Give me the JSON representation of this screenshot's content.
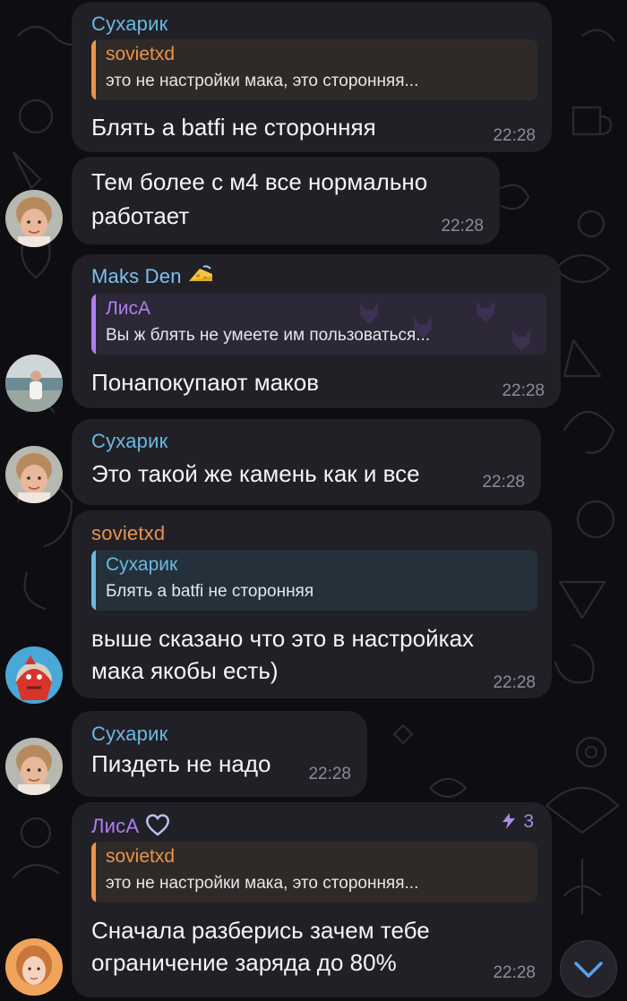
{
  "colors": {
    "background": "#0d0d12",
    "bubble": "#212027",
    "time": "#8d8b96",
    "sender_sukharik": "#6ab8e0",
    "sender_sovietxd": "#e8944a",
    "sender_maks": "#7ac2f0",
    "sender_lisa": "#b07ef0",
    "reply_orange_bg": "#2f2a28",
    "reply_purple_bg": "#2c2838",
    "reply_blue_bg": "#24313a"
  },
  "messages": [
    {
      "sender": "Сухарик",
      "reply": {
        "name": "sovietxd",
        "text": "это не настройки мака, это сторонняя..."
      },
      "text": "Блять а batfi не сторонняя",
      "time": "22:28"
    },
    {
      "text_line1": "Тем более с м4 все нормально",
      "text_line2": "работает",
      "time": "22:28",
      "avatar": "avatar-sukharik"
    },
    {
      "sender": "Maks Den",
      "sender_badge": "cheese-emoji-icon",
      "reply": {
        "name": "ЛисА",
        "text": "Вы ж блять не умеете им пользоваться..."
      },
      "text": "Понапокупают маков",
      "time": "22:28",
      "avatar": "avatar-maks"
    },
    {
      "sender": "Сухарик",
      "text": "Это такой же камень как и все",
      "time": "22:28",
      "avatar": "avatar-sukharik"
    },
    {
      "sender": "sovietxd",
      "reply": {
        "name": "Сухарик",
        "text": "Блять а batfi не сторонняя"
      },
      "text_line1": "выше сказано что это в настройках",
      "text_line2": "мака якобы есть)",
      "time": "22:28",
      "avatar": "avatar-sovietxd"
    },
    {
      "sender": "Сухарик",
      "text": "Пиздеть не надо",
      "time": "22:28",
      "avatar": "avatar-sukharik"
    },
    {
      "sender": "ЛисА",
      "sender_badge": "heart-icon",
      "views": "3",
      "reply": {
        "name": "sovietxd",
        "text": "это не настройки мака, это сторонняя..."
      },
      "text_line1": "Сначала разберись зачем тебе",
      "text_line2": "ограничение заряда до 80%",
      "time": "22:28",
      "avatar": "avatar-lisa"
    }
  ],
  "scroll_button_icon": "chevron-down-icon",
  "views_icon": "boost-icon"
}
